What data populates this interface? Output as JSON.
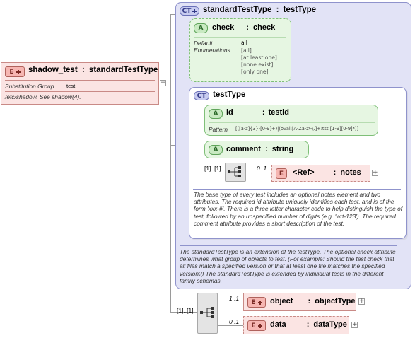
{
  "shadow_test": {
    "badge": "E",
    "name": "shadow_test",
    "sep": ":",
    "type": "standardTestType",
    "substitution_label": "Substitution Group",
    "substitution_value": "test",
    "doc": "/etc/shadow. See shadow(4)."
  },
  "standardTestType": {
    "badge": "CT",
    "name": "standardTestType",
    "sep": ":",
    "type": "testType",
    "doc": "The standardTestType is an extension of the testType.  The optional check attribute determines what group of objects to test.  (For example: Should the test check that all files match a specified version or that at least one file matches the specified version?)  The standardTestType is extended by individual tests in the different family schemas."
  },
  "check_attr": {
    "badge": "A",
    "name": "check",
    "sep": ":",
    "type": "check",
    "default_label": "Default",
    "enum_label": "Enumerations",
    "default_value": "all",
    "enumerations": [
      "[all]",
      "[at least one]",
      "[none exist]",
      "[only one]"
    ]
  },
  "testType": {
    "badge": "CT",
    "name": "testType",
    "doc": "The base type of every test includes an optional notes element and two attributes.  The required id attribute uniquely identifies each test, and is of the form 'xxx-#'.  There is a three letter character code to help distinguish the type of test, followed by an unspecified number of digits (e.g. 'wrt-123').  The required comment attribute provides a short description of the test."
  },
  "id_attr": {
    "badge": "A",
    "name": "id",
    "sep": ":",
    "type": "testid",
    "pattern_label": "Pattern",
    "pattern_value": "[([a-z]{3}-[0-9]+)|(oval:[A-Za-z\\-\\.]+:tst:[1-9][0-9]*)]"
  },
  "comment_attr": {
    "badge": "A",
    "name": "comment",
    "sep": ":",
    "type": "string"
  },
  "inner_seq": {
    "cardinality": "[1]..[1]"
  },
  "notes_ref": {
    "badge": "E",
    "cardinality": "0..1",
    "name": "<Ref>",
    "sep": ":",
    "type": "notes"
  },
  "outer_seq": {
    "cardinality": "[1]..[1]"
  },
  "object_el": {
    "badge": "E",
    "cardinality": "1..1",
    "name": "object",
    "sep": ":",
    "type": "objectType"
  },
  "data_el": {
    "badge": "E",
    "cardinality": "0..1",
    "name": "data",
    "sep": ":",
    "type": "dataType"
  },
  "colors": {
    "element_fill": "#fbe4e3",
    "element_border": "#c98a86",
    "attr_fill": "#e6f6e2",
    "attr_border": "#7fbf78",
    "ct_fill": "#e2e3f6",
    "ct_border": "#8f93cc",
    "connector": "#9a9a9a"
  }
}
